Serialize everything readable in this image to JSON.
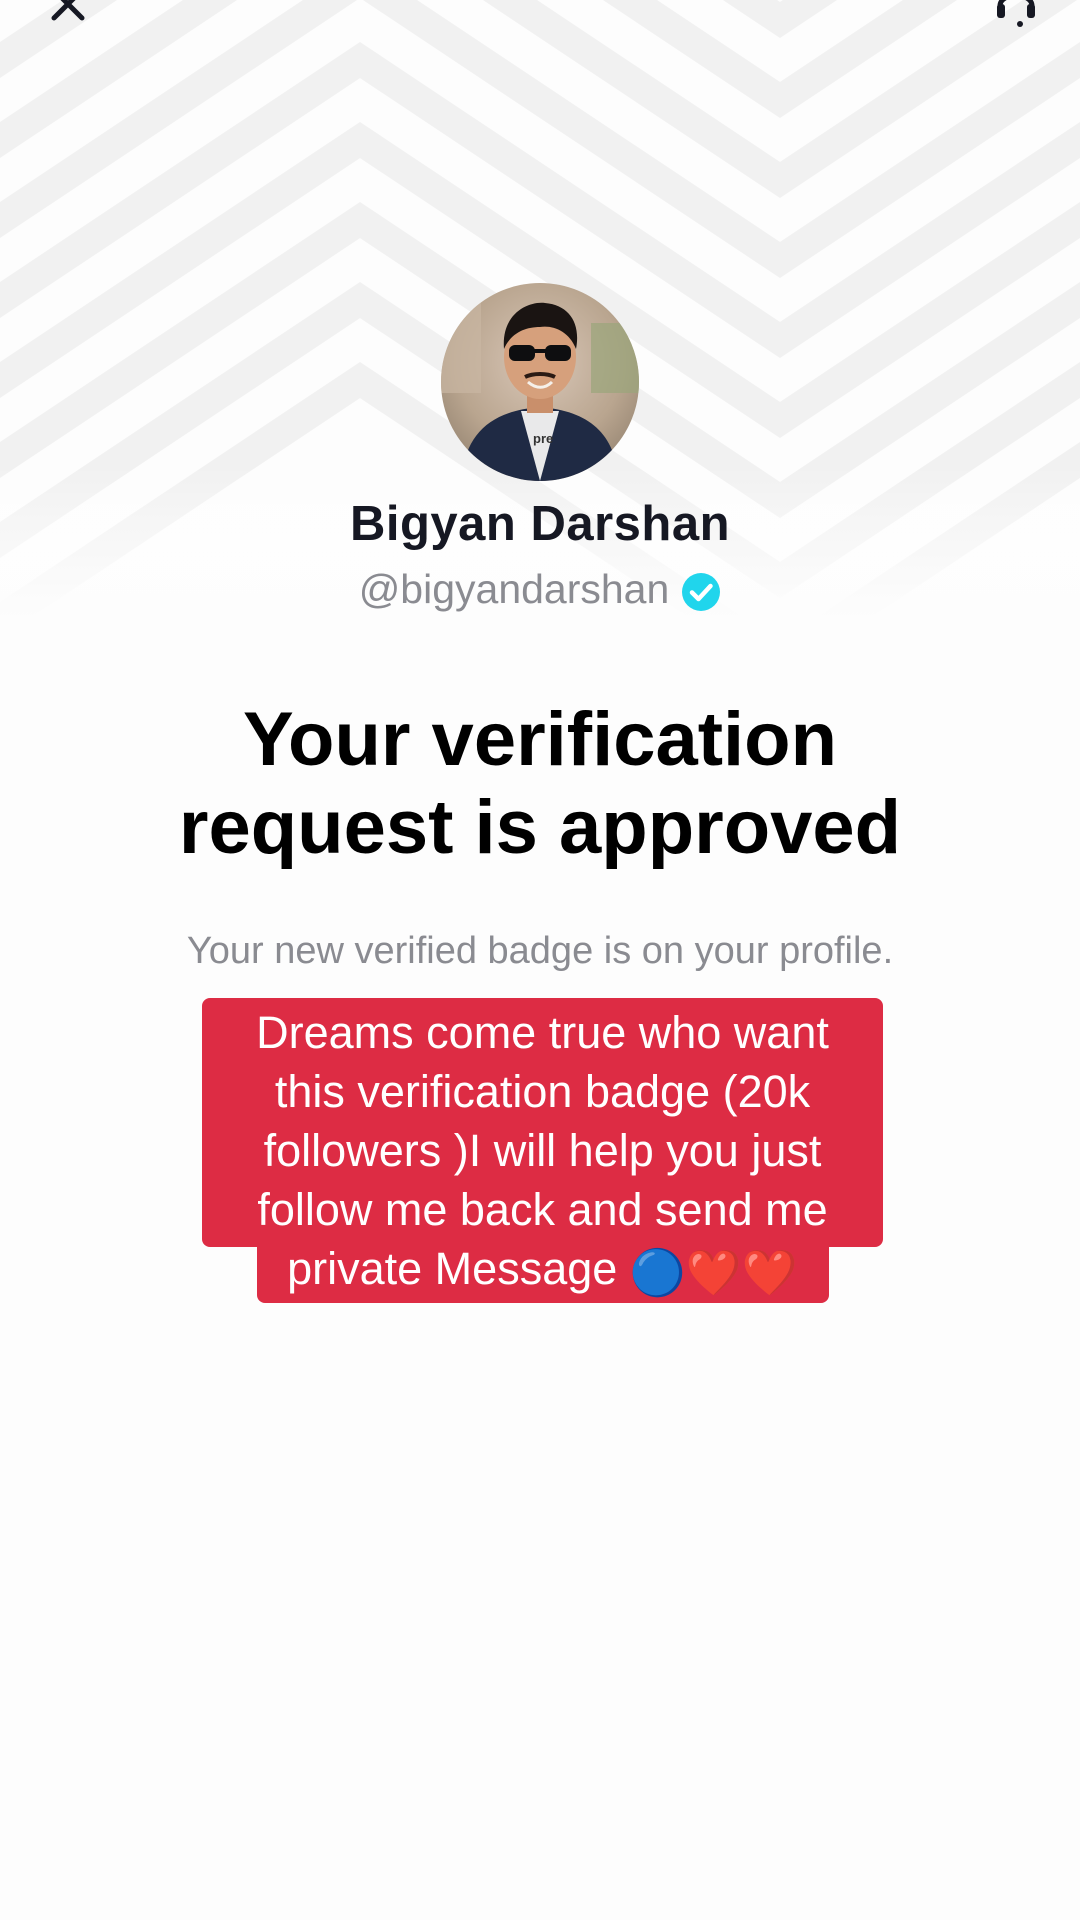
{
  "profile": {
    "display_name": "Bigyan Darshan",
    "handle": "@bigyandarshan"
  },
  "main": {
    "headline_line1": "Your verification",
    "headline_line2": "request is approved",
    "subtext": "Your new verified badge is on your profile."
  },
  "caption": {
    "line1": "Dreams come true who want",
    "line2": "this verification badge (20k",
    "line3": "followers )I will help you just",
    "line4": "follow me back and send me",
    "line5": "private Message",
    "emojis": "🔵❤️❤️"
  },
  "icons": {
    "close": "close-icon",
    "support": "support-icon",
    "verified": "verified-check-icon"
  },
  "colors": {
    "verified_badge": "#20d5ec",
    "caption_background": "#dd2c44",
    "headline": "#000000",
    "subtext": "#8a8b91"
  }
}
